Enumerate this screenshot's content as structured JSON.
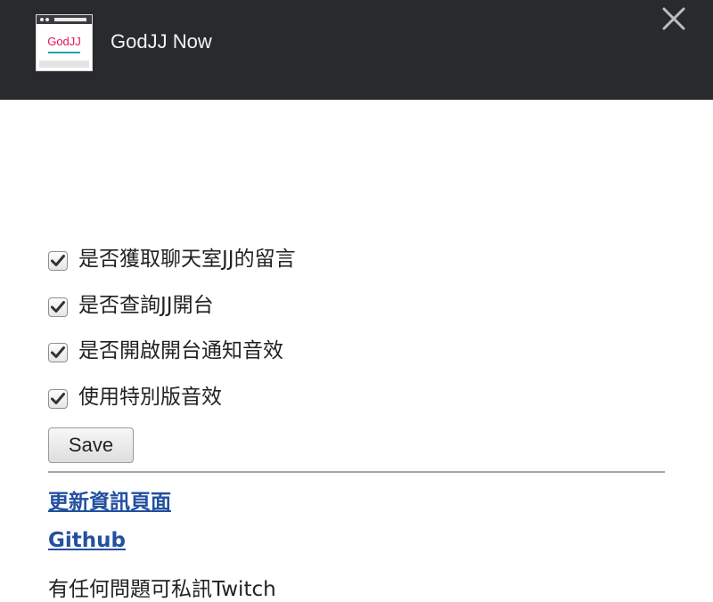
{
  "header": {
    "logo_text": "GodJJ",
    "title": "GodJJ Now",
    "close_icon": "close-icon"
  },
  "options": [
    {
      "label": "是否獲取聊天室JJ的留言",
      "checked": true
    },
    {
      "label": "是否查詢JJ開台",
      "checked": true
    },
    {
      "label": "是否開啟開台通知音效",
      "checked": true
    },
    {
      "label": "使用特別版音效",
      "checked": true
    }
  ],
  "save_label": "Save",
  "links": {
    "update_page": "更新資訊頁面",
    "github": "Github"
  },
  "note": "有任何問題可私訊Twitch",
  "colors": {
    "header_bg": "#282a2e",
    "link": "#23509f",
    "logo_text": "#e6125a"
  }
}
